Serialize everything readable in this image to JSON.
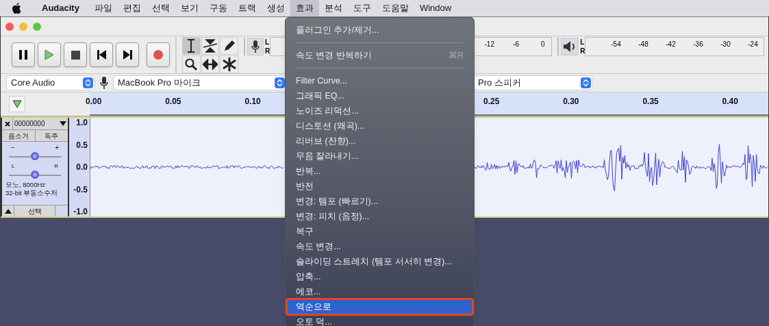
{
  "menubar": {
    "items": [
      {
        "label": "Audacity",
        "kind": "app",
        "selected": false
      },
      {
        "label": "파일",
        "kind": "menu",
        "selected": false
      },
      {
        "label": "편집",
        "kind": "menu",
        "selected": false
      },
      {
        "label": "선택",
        "kind": "menu",
        "selected": false
      },
      {
        "label": "보기",
        "kind": "menu",
        "selected": false
      },
      {
        "label": "구동",
        "kind": "menu",
        "selected": false
      },
      {
        "label": "트랙",
        "kind": "menu",
        "selected": false
      },
      {
        "label": "생성",
        "kind": "menu",
        "selected": false
      },
      {
        "label": "효과",
        "kind": "menu",
        "selected": true
      },
      {
        "label": "분석",
        "kind": "menu",
        "selected": false
      },
      {
        "label": "도구",
        "kind": "menu",
        "selected": false
      },
      {
        "label": "도움말",
        "kind": "menu",
        "selected": false
      },
      {
        "label": "Window",
        "kind": "menu",
        "selected": false
      }
    ]
  },
  "tools": [
    {
      "kind": "ibeam",
      "selected": true
    },
    {
      "kind": "envelope",
      "selected": false
    },
    {
      "kind": "pencil",
      "selected": false
    },
    {
      "kind": "zoom",
      "selected": false
    },
    {
      "kind": "timeshift",
      "selected": false
    },
    {
      "kind": "multi",
      "selected": false
    }
  ],
  "record_meter": {
    "channels": [
      "L",
      "R"
    ],
    "ticks": [
      "-12",
      "-6",
      "0"
    ]
  },
  "play_meter": {
    "channels": [
      "L",
      "R"
    ],
    "ticks": [
      "-54",
      "-48",
      "-42",
      "-36",
      "-30",
      "-24"
    ]
  },
  "devices": {
    "host": "Core Audio",
    "input": "MacBook Pro 마이크",
    "output": "Pro 스피커"
  },
  "ruler": {
    "labels": [
      "0.00",
      "0.05",
      "0.10",
      "0.25",
      "0.30",
      "0.35",
      "0.40"
    ]
  },
  "track": {
    "name": "00000000",
    "mute": "음소거",
    "solo": "독주",
    "gain": {
      "minus": "−",
      "plus": "+",
      "level": 0.5
    },
    "pan": {
      "left": "L",
      "right": "R",
      "level": 0.5
    },
    "info": [
      "모노, 8000Hz",
      "32-bit 부동소수저"
    ],
    "select": "선택",
    "axis": [
      "1.0",
      "0.5",
      "0.0",
      "-0.5",
      "-1.0"
    ]
  },
  "effects_menu": {
    "groups": [
      [
        {
          "label": "플러그인 추가/제거...",
          "selected": false
        }
      ],
      [
        {
          "label": "속도 변경 반복하기",
          "shortcut": "⌘R",
          "selected": false
        }
      ],
      [
        {
          "label": "Filter Curve...",
          "selected": false
        },
        {
          "label": "그래픽 EQ...",
          "selected": false
        },
        {
          "label": "노이즈 리덕션...",
          "selected": false
        },
        {
          "label": "디스토션 (왜곡)...",
          "selected": false
        },
        {
          "label": "리버브 (잔향)...",
          "selected": false
        },
        {
          "label": "무음 잘라내기...",
          "selected": false
        },
        {
          "label": "반복...",
          "selected": false
        },
        {
          "label": "반전",
          "selected": false
        },
        {
          "label": "변경: 템포 (빠르기)...",
          "selected": false
        },
        {
          "label": "변경: 피치 (음정)...",
          "selected": false
        },
        {
          "label": "복구",
          "selected": false
        },
        {
          "label": "속도 변경...",
          "selected": false
        },
        {
          "label": "슬라이딩 스트레치 (템포 서서히 변경)...",
          "selected": false
        },
        {
          "label": "압축...",
          "selected": false
        },
        {
          "label": "에코...",
          "selected": false
        },
        {
          "label": "역순으로",
          "selected": true
        },
        {
          "label": "오토 덕...",
          "selected": false
        }
      ]
    ]
  }
}
